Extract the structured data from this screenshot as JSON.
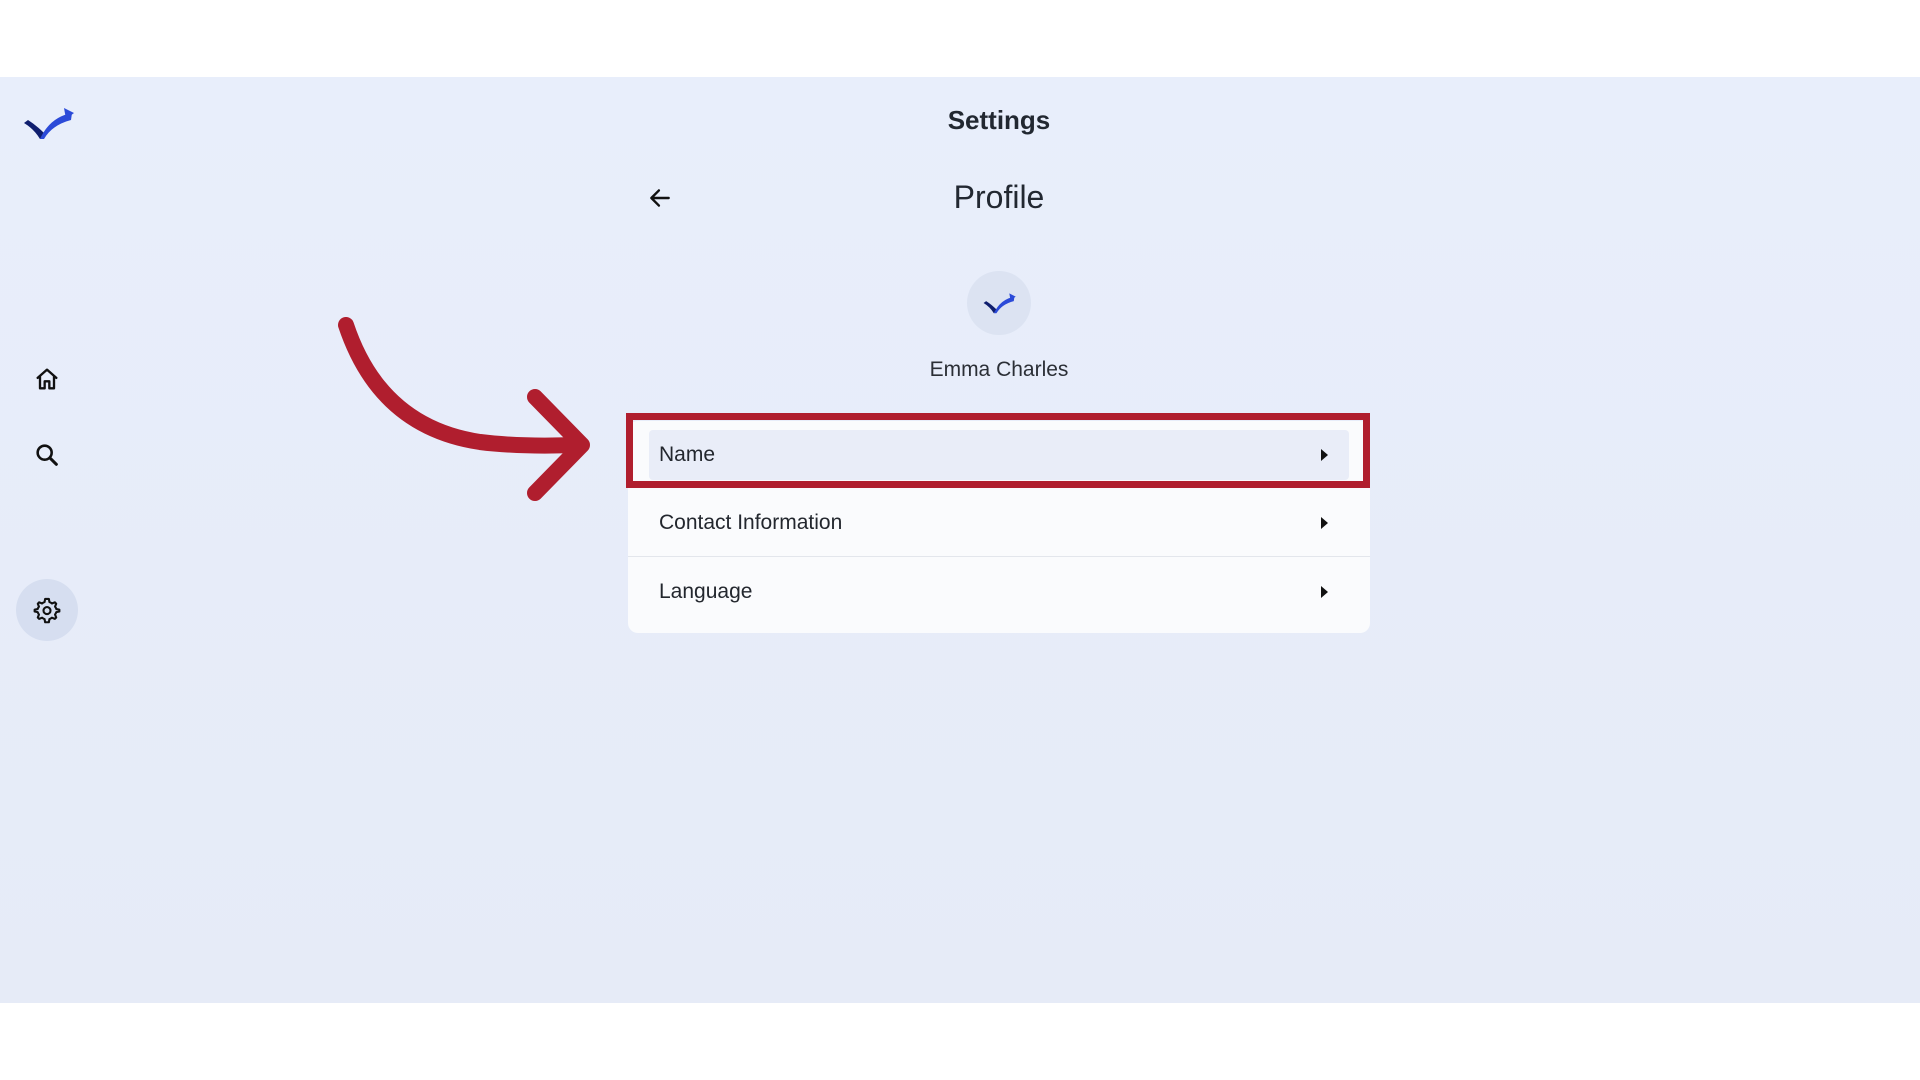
{
  "header": {
    "title": "Settings"
  },
  "page": {
    "title": "Profile"
  },
  "profile": {
    "name": "Emma Charles"
  },
  "menu": {
    "items": [
      {
        "label": "Name"
      },
      {
        "label": "Contact Information"
      },
      {
        "label": "Language"
      }
    ]
  },
  "sidebar": {
    "items": [
      {
        "icon": "home-icon"
      },
      {
        "icon": "search-icon"
      },
      {
        "icon": "gear-icon",
        "active": true
      }
    ]
  },
  "colors": {
    "brand_blue": "#2b4ad8",
    "brand_navy": "#0f1e6e",
    "annotation_red": "#b01e2e",
    "background": "#e8eefb"
  }
}
